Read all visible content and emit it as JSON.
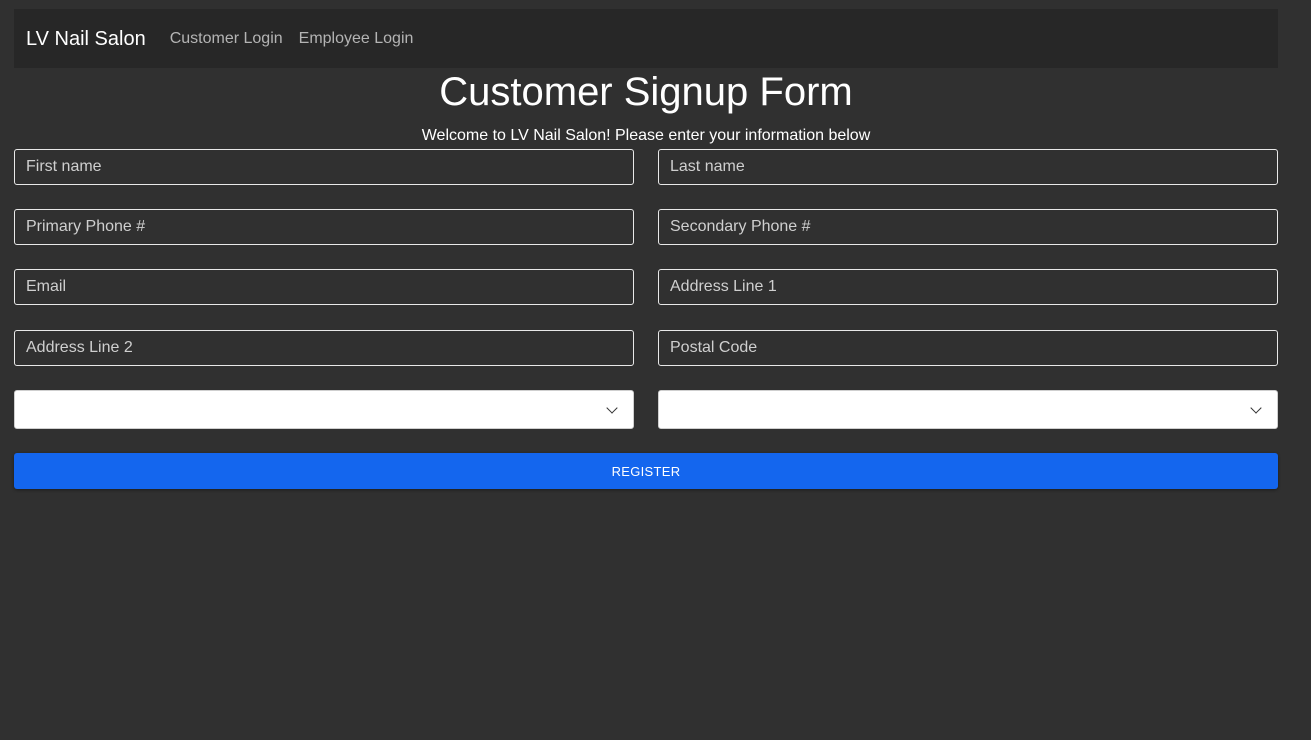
{
  "navbar": {
    "brand": "LV Nail Salon",
    "links": [
      "Customer Login",
      "Employee Login"
    ]
  },
  "page": {
    "title": "Customer Signup Form",
    "subtitle": "Welcome to LV Nail Salon! Please enter your information below"
  },
  "form": {
    "first_name": {
      "placeholder": "First name",
      "value": ""
    },
    "last_name": {
      "placeholder": "Last name",
      "value": ""
    },
    "primary_phone": {
      "placeholder": "Primary Phone #",
      "value": ""
    },
    "secondary_phone": {
      "placeholder": "Secondary Phone #",
      "value": ""
    },
    "email": {
      "placeholder": "Email",
      "value": ""
    },
    "address_line_1": {
      "placeholder": "Address Line 1",
      "value": ""
    },
    "address_line_2": {
      "placeholder": "Address Line 2",
      "value": ""
    },
    "postal_code": {
      "placeholder": "Postal Code",
      "value": ""
    },
    "select_left": {
      "selected": ""
    },
    "select_right": {
      "selected": ""
    },
    "register_label": "REGISTER"
  },
  "colors": {
    "background": "#303030",
    "navbar": "#272727",
    "primary_button": "#1466ee"
  },
  "icons": {
    "select_arrow": "chevron-down-icon"
  }
}
